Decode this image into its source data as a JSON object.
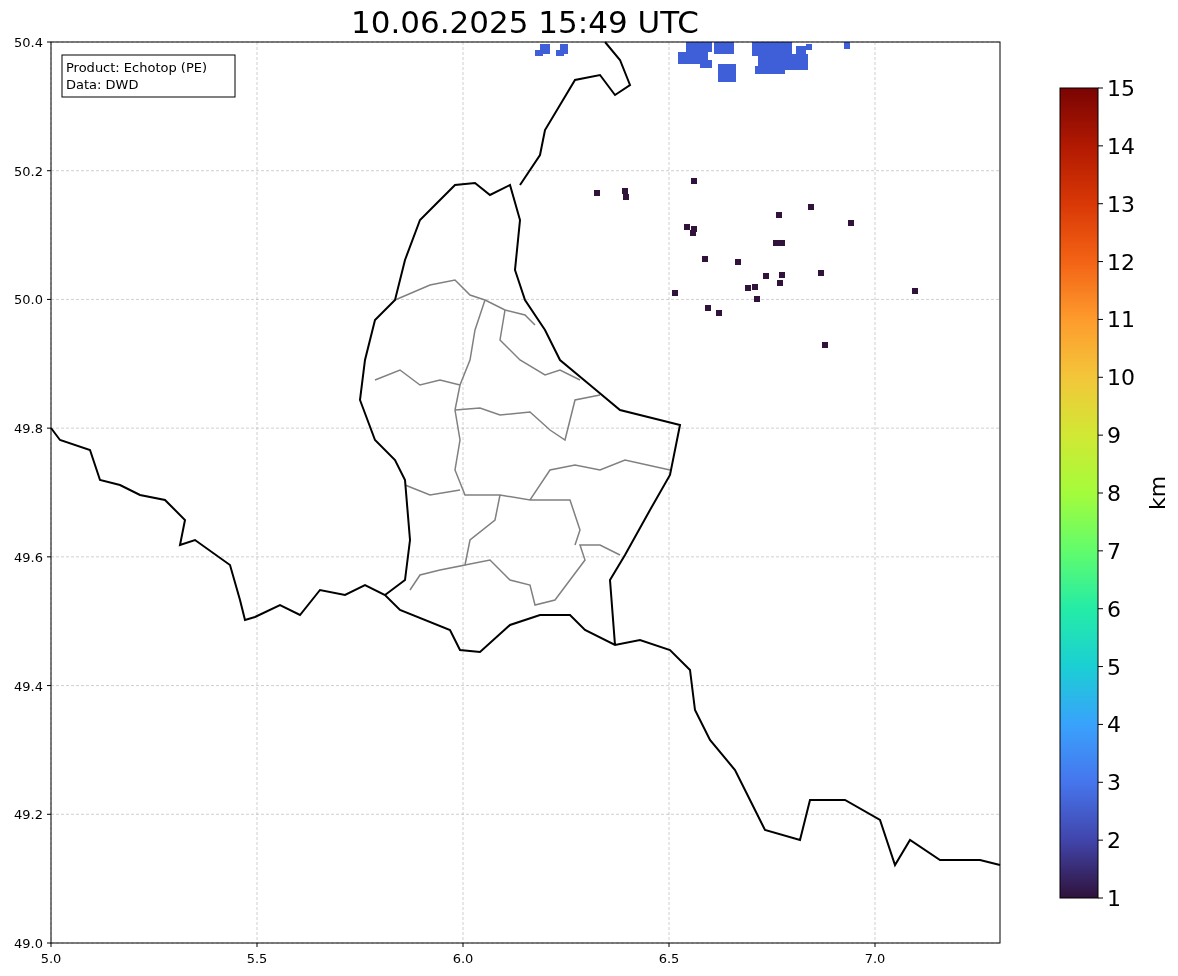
{
  "title": "10.06.2025 15:49 UTC",
  "info_box": {
    "lines": [
      "Product: Echotop (PE)",
      "Data: DWD"
    ]
  },
  "map": {
    "y_ticks": [
      "50.4",
      "50.2",
      "50.0",
      "49.8",
      "49.6",
      "49.4",
      "49.2",
      "49.0"
    ],
    "x_ticks": [
      "5.0",
      "5.5",
      "6.0",
      "6.5",
      "7.0"
    ]
  },
  "colorbar": {
    "label": "km",
    "ticks": [
      "15",
      "14",
      "13",
      "12",
      "11",
      "10",
      "9",
      "8",
      "7",
      "6",
      "5",
      "4",
      "3",
      "2",
      "1"
    ]
  }
}
